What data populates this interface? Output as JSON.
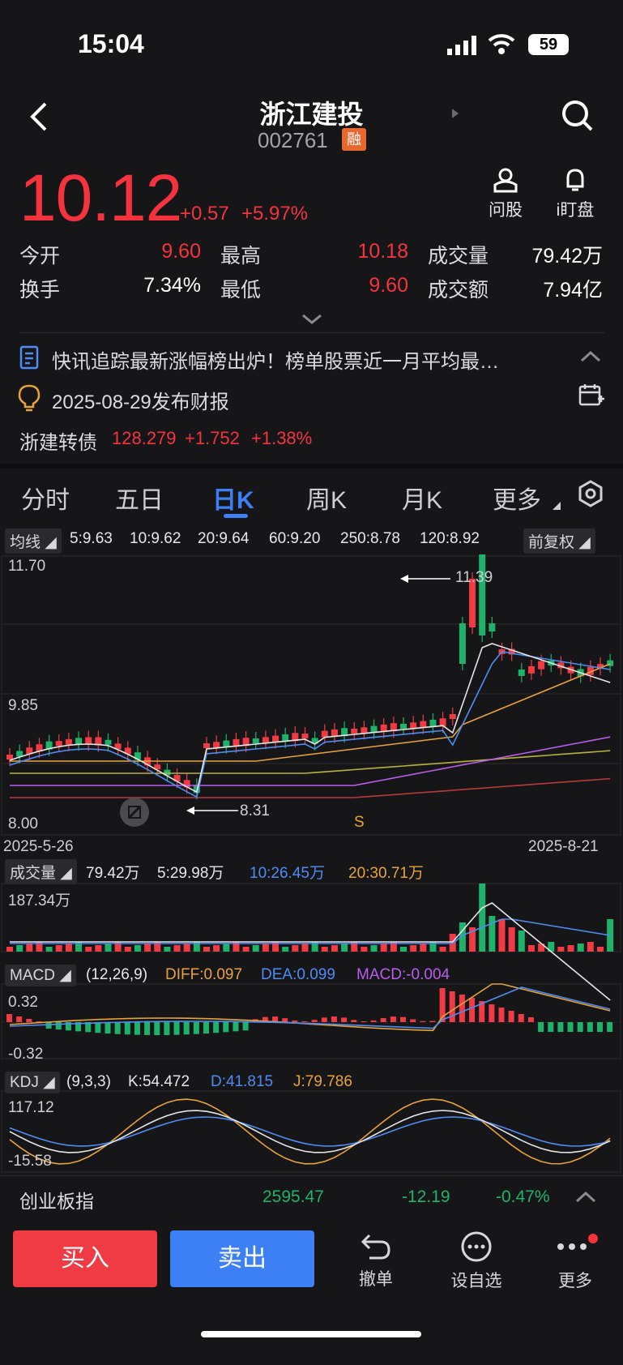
{
  "status": {
    "time": "15:04",
    "battery": "59"
  },
  "header": {
    "title": "浙江建投",
    "code": "002761",
    "badge": "融",
    "actions": [
      {
        "label": "问股"
      },
      {
        "label": "i盯盘"
      }
    ]
  },
  "quote": {
    "price": "10.12",
    "change": "+0.57",
    "pct": "+5.97%",
    "rows": [
      [
        {
          "label": "今开",
          "value": "9.60",
          "color": "red"
        },
        {
          "label": "最高",
          "value": "10.18",
          "color": "red"
        },
        {
          "label": "成交量",
          "value": "79.42万",
          "color": "white"
        }
      ],
      [
        {
          "label": "换手",
          "value": "7.34%",
          "color": "white"
        },
        {
          "label": "最低",
          "value": "9.60",
          "color": "red"
        },
        {
          "label": "成交额",
          "value": "7.94亿",
          "color": "white"
        }
      ]
    ]
  },
  "news": {
    "headline": "快讯追踪最新涨幅榜出炉！榜单股票近一月平均最…",
    "report": "2025-08-29发布财报"
  },
  "bond": {
    "name": "浙建转债",
    "price": "128.279",
    "change": "+1.752",
    "pct": "+1.38%"
  },
  "tabs": [
    "分时",
    "五日",
    "日K",
    "周K",
    "月K",
    "更多"
  ],
  "active_tab": "日K",
  "ma_legend": {
    "button": "均线",
    "items": [
      {
        "text": "5:9.63",
        "color": "#e6e6e6"
      },
      {
        "text": "10:9.62",
        "color": "#4e8cf5"
      },
      {
        "text": "20:9.64",
        "color": "#e8a33a"
      },
      {
        "text": "60:9.20",
        "color": "#b95cf0"
      },
      {
        "text": "250:8.78",
        "color": "#b83a3a"
      },
      {
        "text": "120:8.92",
        "color": "#b9b13a"
      }
    ],
    "adjust": "前复权"
  },
  "kline": {
    "ymax": "11.70",
    "ymid": "9.85",
    "ymin": "8.00",
    "high_mark": "11.39",
    "low_mark": "8.31",
    "s_mark": "S",
    "date_start": "2025-5-26",
    "date_end": "2025-8-21"
  },
  "volume": {
    "button": "成交量",
    "items": [
      {
        "text": "79.42万",
        "color": "#e6e6e6"
      },
      {
        "text": "5:29.98万",
        "color": "#e6e6e6"
      },
      {
        "text": "10:26.45万",
        "color": "#4e8cf5"
      },
      {
        "text": "20:30.71万",
        "color": "#e8a33a"
      }
    ],
    "max_label": "187.34万"
  },
  "macd": {
    "button": "MACD",
    "items": [
      {
        "text": "(12,26,9)",
        "color": "#e6e6e6"
      },
      {
        "text": "DIFF:0.097",
        "color": "#e8a33a"
      },
      {
        "text": "DEA:0.099",
        "color": "#4e8cf5"
      },
      {
        "text": "MACD:-0.004",
        "color": "#b95cf0"
      }
    ],
    "top": "0.32",
    "bottom": "-0.32"
  },
  "kdj": {
    "button": "KDJ",
    "items": [
      {
        "text": "(9,3,3)",
        "color": "#e6e6e6"
      },
      {
        "text": "K:54.472",
        "color": "#e6e6e6"
      },
      {
        "text": "D:41.815",
        "color": "#4e8cf5"
      },
      {
        "text": "J:79.786",
        "color": "#e8a33a"
      }
    ],
    "top": "117.12",
    "bottom": "-15.58"
  },
  "index_bar": {
    "name": "创业板指",
    "value": "2595.47",
    "change": "-12.19",
    "pct": "-0.47%"
  },
  "bottom": {
    "buy": "买入",
    "sell": "卖出",
    "actions": [
      {
        "label": "撤单"
      },
      {
        "label": "设自选"
      },
      {
        "label": "更多"
      }
    ]
  },
  "colors": {
    "up": "#f5333f",
    "down": "#1fb26b",
    "accent": "#3d7ff5"
  }
}
